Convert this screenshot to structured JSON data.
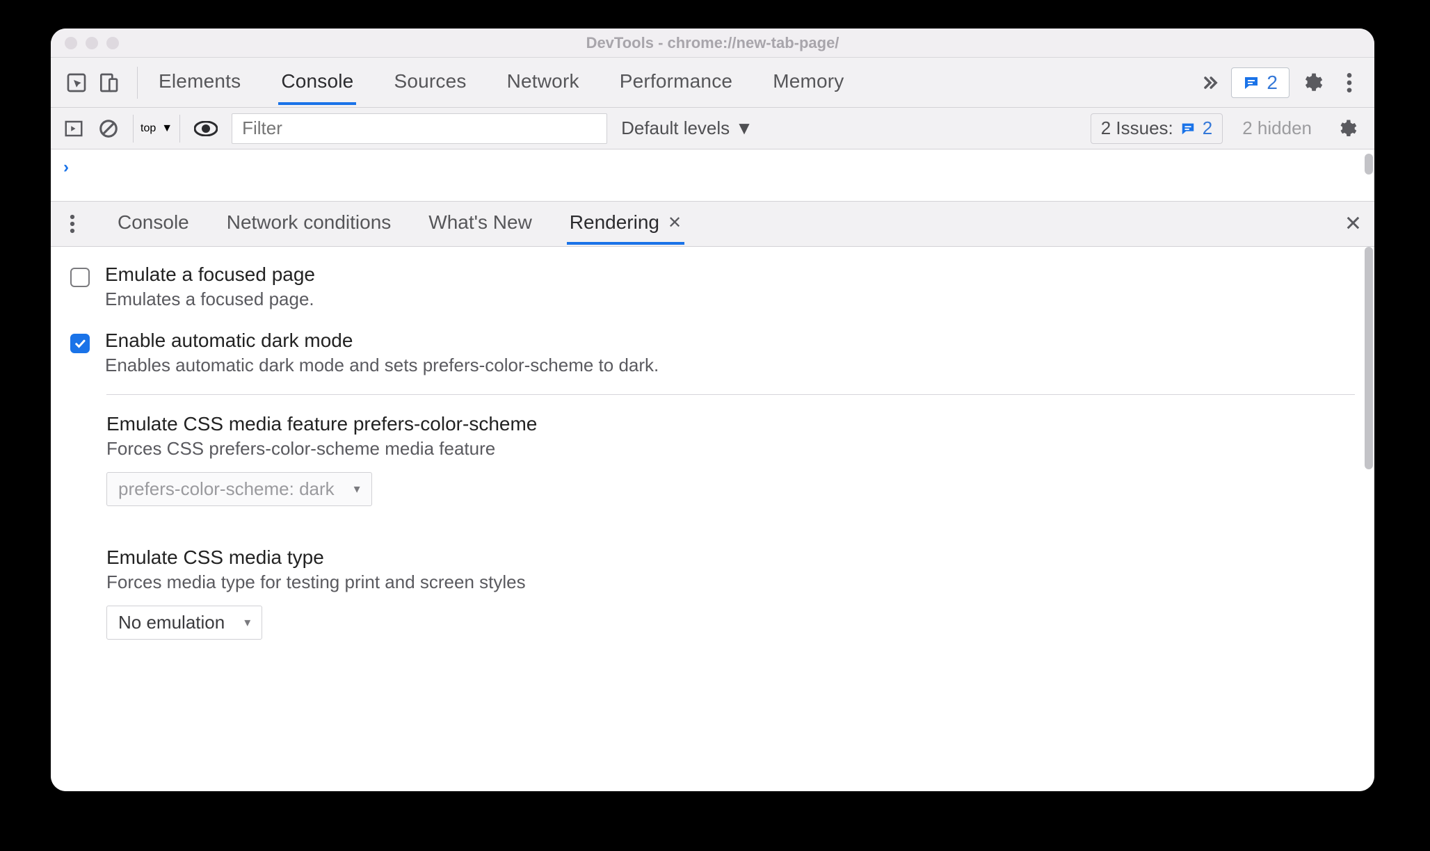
{
  "window": {
    "title": "DevTools - chrome://new-tab-page/"
  },
  "mainTabs": {
    "elements": "Elements",
    "console": "Console",
    "sources": "Sources",
    "network": "Network",
    "performance": "Performance",
    "memory": "Memory"
  },
  "badge": {
    "count": "2"
  },
  "consoleBar": {
    "context": "top",
    "filterPlaceholder": "Filter",
    "levelsLabel": "Default levels",
    "issuesLabel": "2 Issues:",
    "issuesCount": "2",
    "hiddenLabel": "2 hidden"
  },
  "drawerTabs": {
    "console": "Console",
    "networkConditions": "Network conditions",
    "whatsNew": "What's New",
    "rendering": "Rendering"
  },
  "settings": {
    "focused": {
      "title": "Emulate a focused page",
      "desc": "Emulates a focused page."
    },
    "darkMode": {
      "title": "Enable automatic dark mode",
      "desc": "Enables automatic dark mode and sets prefers-color-scheme to dark."
    },
    "prefersColorScheme": {
      "title": "Emulate CSS media feature prefers-color-scheme",
      "desc": "Forces CSS prefers-color-scheme media feature",
      "value": "prefers-color-scheme: dark"
    },
    "mediaType": {
      "title": "Emulate CSS media type",
      "desc": "Forces media type for testing print and screen styles",
      "value": "No emulation"
    }
  }
}
